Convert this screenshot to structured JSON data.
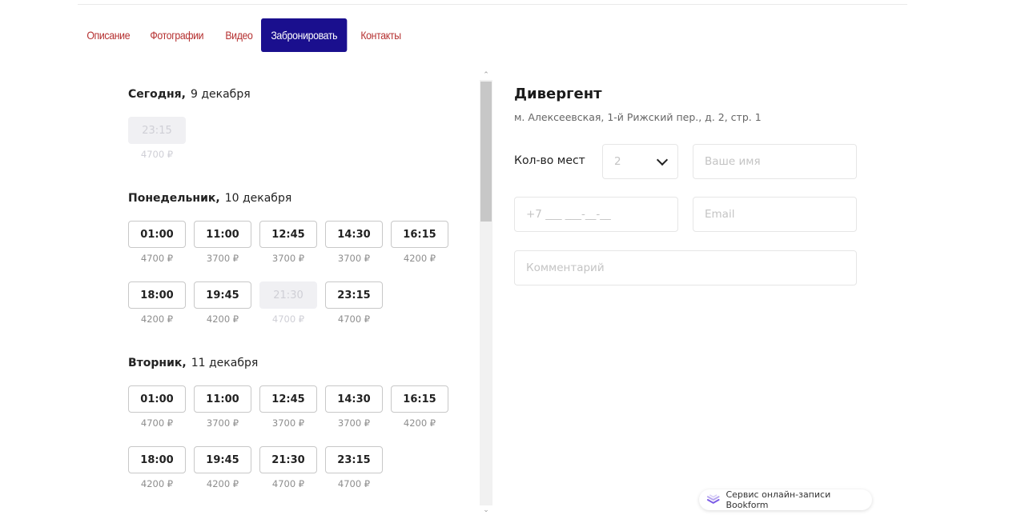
{
  "tabs": [
    {
      "label": "Описание"
    },
    {
      "label": "Фотографии"
    },
    {
      "label": "Видео"
    },
    {
      "label": "Забронировать",
      "active": true
    },
    {
      "label": "Контакты"
    }
  ],
  "schedule": [
    {
      "day_name": "Сегодня,",
      "date": "9 декабря",
      "slots": [
        {
          "time": "23:15",
          "price": "4700 ₽",
          "available": false
        }
      ]
    },
    {
      "day_name": "Понедельник,",
      "date": "10 декабря",
      "slots": [
        {
          "time": "01:00",
          "price": "4700 ₽",
          "available": true
        },
        {
          "time": "11:00",
          "price": "3700 ₽",
          "available": true
        },
        {
          "time": "12:45",
          "price": "3700 ₽",
          "available": true
        },
        {
          "time": "14:30",
          "price": "3700 ₽",
          "available": true
        },
        {
          "time": "16:15",
          "price": "4200 ₽",
          "available": true
        },
        {
          "time": "18:00",
          "price": "4200 ₽",
          "available": true
        },
        {
          "time": "19:45",
          "price": "4200 ₽",
          "available": true
        },
        {
          "time": "21:30",
          "price": "4700 ₽",
          "available": false
        },
        {
          "time": "23:15",
          "price": "4700 ₽",
          "available": true
        }
      ]
    },
    {
      "day_name": "Вторник,",
      "date": "11 декабря",
      "slots": [
        {
          "time": "01:00",
          "price": "4700 ₽",
          "available": true
        },
        {
          "time": "11:00",
          "price": "3700 ₽",
          "available": true
        },
        {
          "time": "12:45",
          "price": "3700 ₽",
          "available": true
        },
        {
          "time": "14:30",
          "price": "3700 ₽",
          "available": true
        },
        {
          "time": "16:15",
          "price": "4200 ₽",
          "available": true
        },
        {
          "time": "18:00",
          "price": "4200 ₽",
          "available": true
        },
        {
          "time": "19:45",
          "price": "4200 ₽",
          "available": true
        },
        {
          "time": "21:30",
          "price": "4700 ₽",
          "available": true
        },
        {
          "time": "23:15",
          "price": "4700 ₽",
          "available": true
        }
      ]
    }
  ],
  "venue": {
    "title": "Дивергент",
    "address": "м. Алексеевская, 1-й Рижский пер., д. 2, стр. 1"
  },
  "form": {
    "seats_label": "Кол-во мест",
    "seats_value": "2",
    "name_placeholder": "Ваше имя",
    "phone_placeholder": "+7 ___ ___-__-__",
    "email_placeholder": "Email",
    "comment_placeholder": "Комментарий"
  },
  "footer": {
    "badge_text": "Сервис онлайн-записи Bookform"
  },
  "colors": {
    "accent": "#1a0f8e",
    "tab_text": "#b53030",
    "disabled_bg": "#f0f0f3"
  }
}
